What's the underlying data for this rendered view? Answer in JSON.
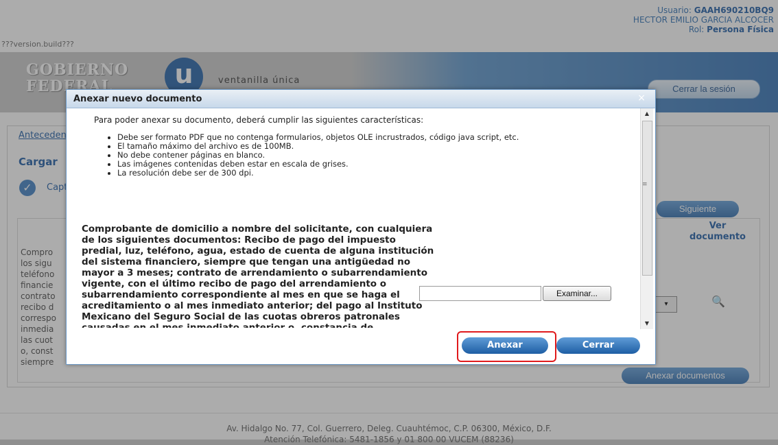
{
  "header": {
    "version": "???version.build???",
    "user_label": "Usuario: ",
    "user_id": "GAAH690210BQ9",
    "user_name": "HECTOR EMILIO GARCIA ALCOCER",
    "role_label": "Rol: ",
    "role": "Persona Física"
  },
  "banner": {
    "gobierno": "GOBIERNO",
    "federal": "FEDERAL",
    "u_letter": "u",
    "ventanilla": "ventanilla única",
    "logout": "Cerrar la sesión"
  },
  "page": {
    "breadcrumb": "Antecedentes",
    "section_title": "Cargar",
    "step_label": "Captura",
    "next_button": "Siguiente",
    "ver_documento": "Ver documento",
    "bg_text_lines": [
      "Compro",
      "los sigu",
      "teléfono",
      "financie",
      "contrato",
      "recibo d",
      "correspo",
      "inmedia",
      "las cuot",
      "o, const",
      "siempre"
    ],
    "anexar_documentos": "Anexar documentos",
    "select_arrow": "▾",
    "magnifier": "🔍"
  },
  "dialog": {
    "title": "Anexar nuevo documento",
    "close": "×",
    "intro": "Para poder anexar su documento, deberá cumplir las siguientes características:",
    "bullets": [
      "Debe ser formato PDF que no contenga formularios, objetos OLE incrustrados, código java script, etc.",
      "El tamaño máximo del archivo es de 100MB.",
      "No debe contener páginas en blanco.",
      "Las imágenes contenidas deben estar en escala de grises.",
      "La resolución debe ser de 300 dpi."
    ],
    "requirement": "Comprobante de domicilio a nombre del solicitante, con cualquiera de los siguientes documentos: Recibo de pago del impuesto predial, luz, teléfono, agua, estado de cuenta de alguna institución del sistema financiero, siempre que tengan una antigüedad no mayor a 3 meses; contrato de arrendamiento o subarrendamiento vigente, con el último recibo de pago del arrendamiento o subarrendamiento correspondiente al mes en que se haga el acreditamiento o al mes inmediato anterior; del pago al Instituto Mexicano del Seguro Social de las cuotas obreros patronales causadas en el mes inmediato anterior o, constancia de",
    "file_value": "",
    "browse_button": "Examinar...",
    "attach_button": "Anexar",
    "close_button": "Cerrar"
  },
  "footer": {
    "address": "Av. Hidalgo No. 77, Col. Guerrero, Deleg. Cuauhtémoc, C.P. 06300, México, D.F.",
    "phone": "Atención Telefónica: 5481-1856 y 01 800 00 VUCEM (88236)"
  }
}
